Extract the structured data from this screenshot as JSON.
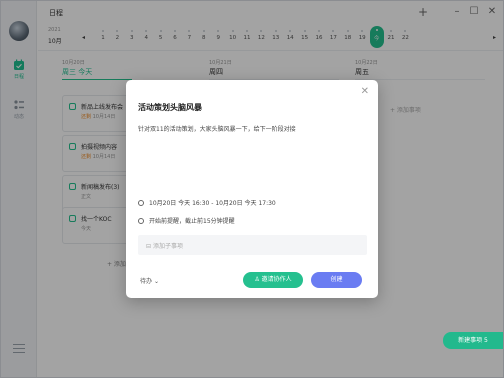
{
  "app": {
    "title": "日程"
  },
  "rail": {
    "items": [
      {
        "label": "日程",
        "icon": "calendar-icon"
      },
      {
        "label": "动态",
        "icon": "activity-icon"
      }
    ]
  },
  "date_strip": {
    "year": "2021",
    "month": "10月",
    "days": [
      "1",
      "2",
      "3",
      "4",
      "5",
      "6",
      "7",
      "8",
      "9",
      "10",
      "11",
      "12",
      "13",
      "14",
      "15",
      "16",
      "17",
      "18",
      "19",
      "20",
      "21",
      "22"
    ],
    "today": {
      "num": "20",
      "label": "今"
    }
  },
  "columns": [
    {
      "date": "10月20日",
      "weekday": "周三 今天",
      "today": true
    },
    {
      "date": "",
      "weekday": "周四",
      "today": false
    },
    {
      "date": "10月21日",
      "weekday": "周四",
      "today": false
    },
    {
      "date": "10月22日",
      "weekday": "周五",
      "today": false
    }
  ],
  "cards": [
    {
      "title": "新品上线发布会",
      "sub_warn": "还剩",
      "sub": "10月14日"
    },
    {
      "title": "拍摄视频内容",
      "sub_warn": "还剩",
      "sub": "10月14日"
    },
    {
      "title": "新闻稿发布(3)",
      "sub_warn": "",
      "sub": "正文"
    },
    {
      "title": "找一个KOC",
      "sub_warn": "",
      "sub": "今天"
    }
  ],
  "add_left": "+ 添加",
  "add_right": "+ 添加事项",
  "modal": {
    "title": "活动策划头脑风暴",
    "description": "针对双11的活动策划，大家头脑风暴一下，给下一阶段对接",
    "time": "10月20日 今天 16:30 - 10月20日 今天 17:30",
    "reminder": "开始前提醒，截止前15分钟提醒",
    "subtask_placeholder": "添加子事项",
    "status": "待办",
    "invite_label": "邀请协作人",
    "create_label": "创建"
  },
  "fab": {
    "label": "新建事项 5"
  },
  "colors": {
    "accent": "#25c08f",
    "primary": "#6a7cf2"
  }
}
